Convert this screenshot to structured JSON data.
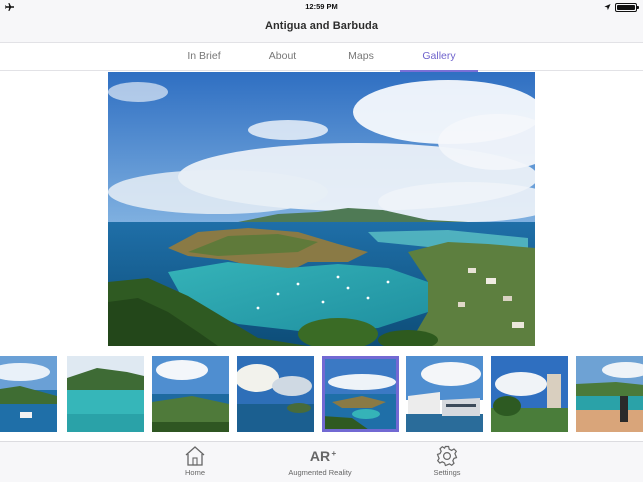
{
  "status_bar": {
    "time": "12:59 PM",
    "airplane_icon": "airplane-icon",
    "location_icon": "location-arrow-icon",
    "battery_level": 1.0
  },
  "navbar": {
    "title": "Antigua and Barbuda"
  },
  "tabs": [
    {
      "label": "In Brief",
      "active": false
    },
    {
      "label": "About",
      "active": false
    },
    {
      "label": "Maps",
      "active": false
    },
    {
      "label": "Gallery",
      "active": true
    }
  ],
  "gallery": {
    "selected_index": 4,
    "thumbnail_count": 8
  },
  "tabbar": {
    "items": [
      {
        "label": "Home",
        "icon": "house-icon"
      },
      {
        "label": "Augmented Reality",
        "icon": "ar-icon",
        "glyph": "AR",
        "glyph_sup": "+"
      },
      {
        "label": "Settings",
        "icon": "gear-icon"
      }
    ]
  },
  "colors": {
    "accent": "#7269d3",
    "tab_active": "#6f63cc",
    "bar_bg": "#f7f7f9"
  }
}
